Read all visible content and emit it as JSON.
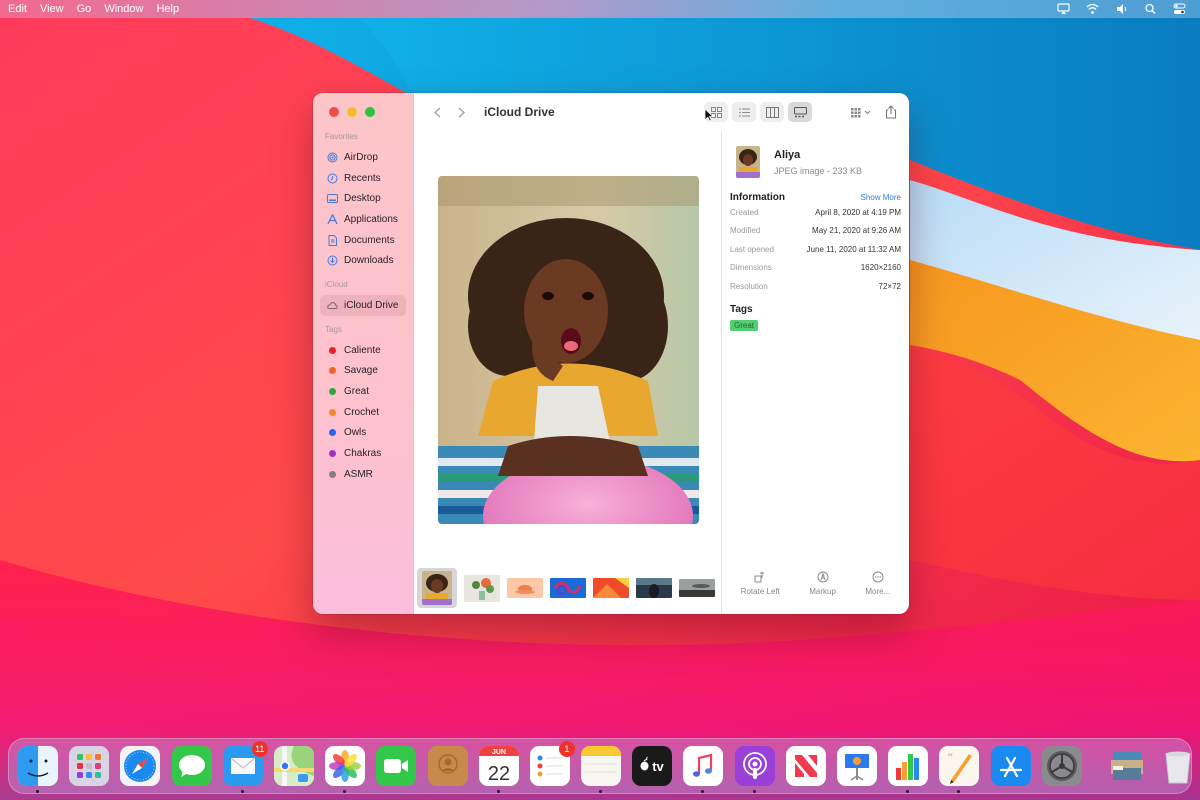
{
  "menubar": {
    "items": [
      "Edit",
      "View",
      "Go",
      "Window",
      "Help"
    ],
    "status_icons": [
      "airplay-icon",
      "wifi-icon",
      "volume-icon",
      "spotlight-search-icon",
      "control-center-icon"
    ]
  },
  "window": {
    "title": "iCloud Drive",
    "sidebar": {
      "favorites_label": "Favorites",
      "favorites": [
        {
          "label": "AirDrop",
          "icon": "airdrop-icon"
        },
        {
          "label": "Recents",
          "icon": "clock-icon"
        },
        {
          "label": "Desktop",
          "icon": "desktop-icon"
        },
        {
          "label": "Applications",
          "icon": "applications-icon"
        },
        {
          "label": "Documents",
          "icon": "document-icon"
        },
        {
          "label": "Downloads",
          "icon": "download-icon"
        }
      ],
      "icloud_label": "iCloud",
      "icloud_items": [
        {
          "label": "iCloud Drive",
          "icon": "cloud-icon",
          "selected": true
        }
      ],
      "tags_label": "Tags",
      "tags": [
        {
          "label": "Caliente",
          "color": "#e8202a"
        },
        {
          "label": "Savage",
          "color": "#f0642a"
        },
        {
          "label": "Great",
          "color": "#2aa83a"
        },
        {
          "label": "Crochet",
          "color": "#f08a30"
        },
        {
          "label": "Owls",
          "color": "#2a64f0"
        },
        {
          "label": "Chakras",
          "color": "#a030c8"
        },
        {
          "label": "ASMR",
          "color": "#8a7a86"
        }
      ]
    },
    "toolbar": {
      "view_modes": [
        "icon-view",
        "list-view",
        "column-view",
        "gallery-view"
      ],
      "active_view": "gallery-view"
    },
    "gallery": {
      "thumbnails": [
        "portrait-girl",
        "flowers",
        "orange-cup",
        "blue-abstract",
        "orange-shapes",
        "dark-portrait",
        "landscape-sky"
      ],
      "selected_index": 0
    },
    "inspector": {
      "file_name": "Aliya",
      "file_kind": "JPEG image - 233 KB",
      "information_label": "Information",
      "show_more_label": "Show More",
      "rows": [
        {
          "key": "Created",
          "value": "April 8, 2020 at 4:19 PM"
        },
        {
          "key": "Modified",
          "value": "May 21, 2020 at 9:26 AM"
        },
        {
          "key": "Last opened",
          "value": "June 11, 2020 at 11:32 AM"
        },
        {
          "key": "Dimensions",
          "value": "1620×2160"
        },
        {
          "key": "Resolution",
          "value": "72×72"
        }
      ],
      "tags_label": "Tags",
      "tag": {
        "label": "Great",
        "color": "#34c759"
      },
      "actions": [
        {
          "label": "Rotate Left",
          "icon": "rotate-left-icon"
        },
        {
          "label": "Markup",
          "icon": "markup-icon"
        },
        {
          "label": "More...",
          "icon": "more-icon"
        }
      ]
    }
  },
  "dock": {
    "apps": [
      {
        "name": "Finder",
        "running": true
      },
      {
        "name": "Launchpad",
        "running": false
      },
      {
        "name": "Safari",
        "running": false
      },
      {
        "name": "Messages",
        "running": false
      },
      {
        "name": "Mail",
        "running": true,
        "badge": "11"
      },
      {
        "name": "Maps",
        "running": false
      },
      {
        "name": "Photos",
        "running": true
      },
      {
        "name": "FaceTime",
        "running": false
      },
      {
        "name": "Contacts",
        "running": false
      },
      {
        "name": "Calendar",
        "running": true,
        "month": "JUN",
        "day": "22"
      },
      {
        "name": "Reminders",
        "running": false,
        "badge": "1"
      },
      {
        "name": "Notes",
        "running": true
      },
      {
        "name": "TV",
        "running": false,
        "label": "tv"
      },
      {
        "name": "Music",
        "running": true
      },
      {
        "name": "Podcasts",
        "running": true
      },
      {
        "name": "News",
        "running": false
      },
      {
        "name": "Keynote",
        "running": false
      },
      {
        "name": "Numbers",
        "running": true
      },
      {
        "name": "Pages",
        "running": true
      },
      {
        "name": "App Store",
        "running": false
      },
      {
        "name": "System Preferences",
        "running": false
      }
    ],
    "extras": [
      {
        "name": "Downloads Stack"
      },
      {
        "name": "Trash"
      }
    ]
  }
}
